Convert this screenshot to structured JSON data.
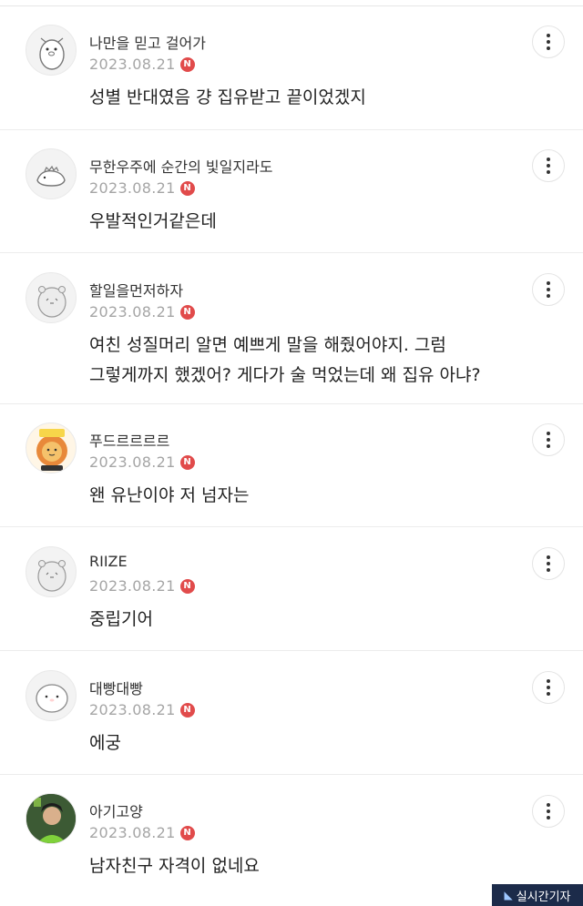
{
  "comments": [
    {
      "nickname": "나만을 믿고 걸어가",
      "date": "2023.08.21",
      "badge": "N",
      "lines": [
        "성별 반대였음 걍 집유받고 끝이었겠지"
      ],
      "avatar_icon": "cartoon-bear-icon"
    },
    {
      "nickname": "무한우주에 순간의 빛일지라도",
      "date": "2023.08.21",
      "badge": "N",
      "lines": [
        "우발적인거같은데"
      ],
      "avatar_icon": "cartoon-dino-icon"
    },
    {
      "nickname": "할일을먼저하자",
      "date": "2023.08.21",
      "badge": "N",
      "lines": [
        "여친 성질머리 알면 예쁘게 말을 해줬어야지. 그럼",
        "그렇게까지 했겠어? 게다가 술 먹었는데 왜 집유 아냐?"
      ],
      "avatar_icon": "cartoon-hamster-icon"
    },
    {
      "nickname": "푸드르르르르",
      "date": "2023.08.21",
      "badge": "N",
      "lines": [
        "왠 유난이야 저 넘자는"
      ],
      "avatar_icon": "cartoon-lion-icon"
    },
    {
      "nickname": "RIIZE",
      "date": "2023.08.21",
      "badge": "N",
      "lines": [
        "중립기어"
      ],
      "avatar_icon": "cartoon-hamster-icon"
    },
    {
      "nickname": "대빵대빵",
      "date": "2023.08.21",
      "badge": "N",
      "lines": [
        "에궁"
      ],
      "avatar_icon": "cartoon-blob-icon"
    },
    {
      "nickname": "아기고양",
      "date": "2023.08.21",
      "badge": "N",
      "lines": [
        "남자친구 자격이 없네요"
      ],
      "avatar_icon": "photo-avatar-icon"
    }
  ],
  "watermark": {
    "label": "실시간기자"
  }
}
